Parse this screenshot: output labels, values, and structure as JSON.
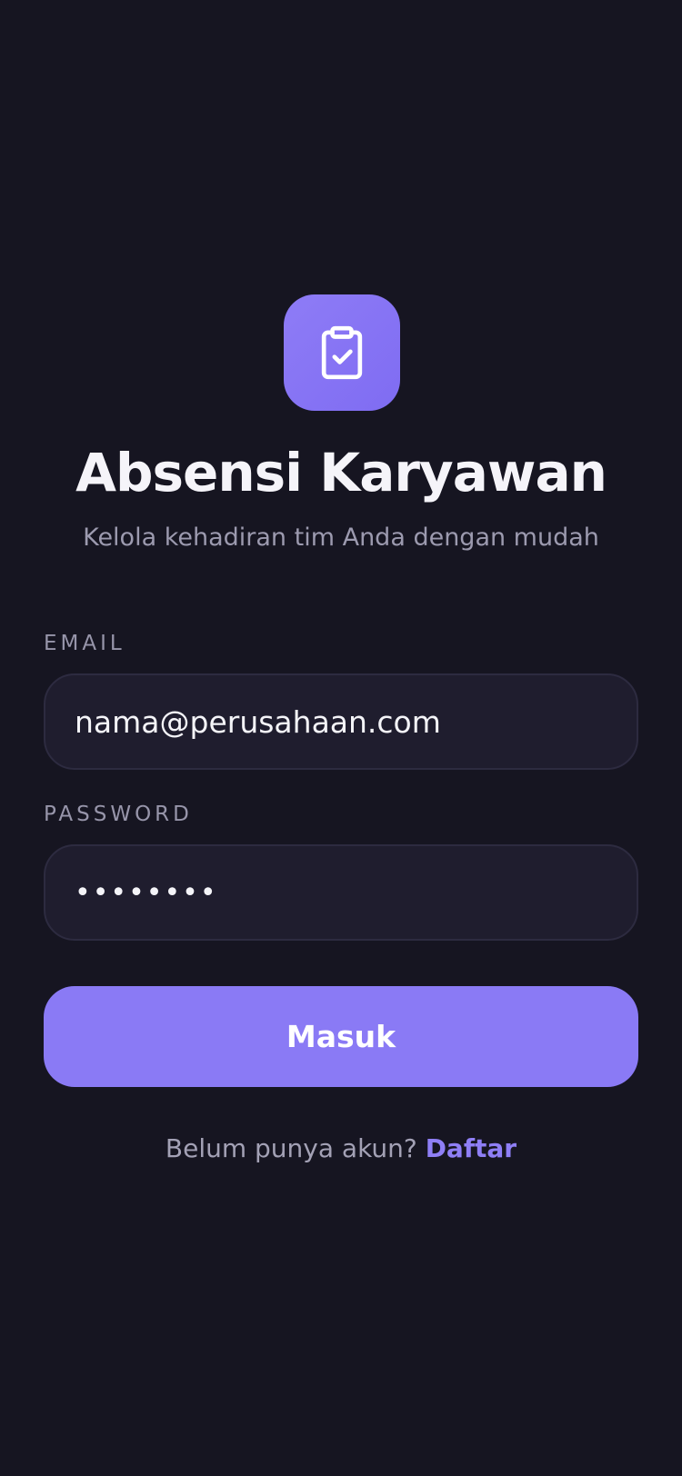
{
  "app": {
    "icon": "clipboard-check-icon",
    "title": "Absensi Karyawan",
    "subtitle": "Kelola kehadiran tim Anda dengan mudah"
  },
  "form": {
    "email": {
      "label": "EMAIL",
      "value": "nama@perusahaan.com"
    },
    "password": {
      "label": "PASSWORD",
      "value": "••••••••"
    },
    "submit_label": "Masuk"
  },
  "footer": {
    "prompt": "Belum punya akun? ",
    "link_label": "Daftar"
  },
  "colors": {
    "background": "#161521",
    "accent": "#8a7af5",
    "field_background": "#1f1d2e",
    "muted_text": "#9c9aaf"
  }
}
